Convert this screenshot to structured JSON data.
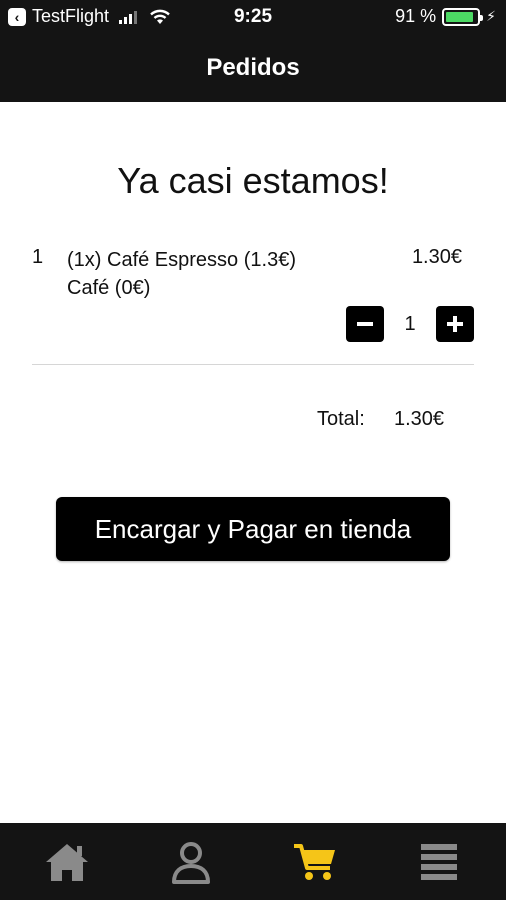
{
  "status_bar": {
    "back_app": "TestFlight",
    "time": "9:25",
    "battery_percent": "91 %",
    "battery_level": 0.91
  },
  "nav": {
    "title": "Pedidos"
  },
  "main": {
    "heading": "Ya casi estamos!",
    "order_items": [
      {
        "number": "1",
        "line1": "(1x) Café Espresso (1.3€)",
        "line2": "Café (0€)",
        "price": "1.30€",
        "quantity": "1"
      }
    ],
    "total_label": "Total:",
    "total_value": "1.30€",
    "cta_label": "Encargar y Pagar en tienda"
  },
  "tab_bar": {
    "items": [
      {
        "icon": "home-icon",
        "active": false
      },
      {
        "icon": "user-icon",
        "active": false
      },
      {
        "icon": "cart-icon",
        "active": true
      },
      {
        "icon": "menu-icon",
        "active": false
      }
    ]
  },
  "colors": {
    "bar_bg": "#141414",
    "accent_active_tab": "#f5c518",
    "inactive_icon": "#8a8a8a",
    "button_bg": "#000000",
    "battery": "#4cd964"
  }
}
